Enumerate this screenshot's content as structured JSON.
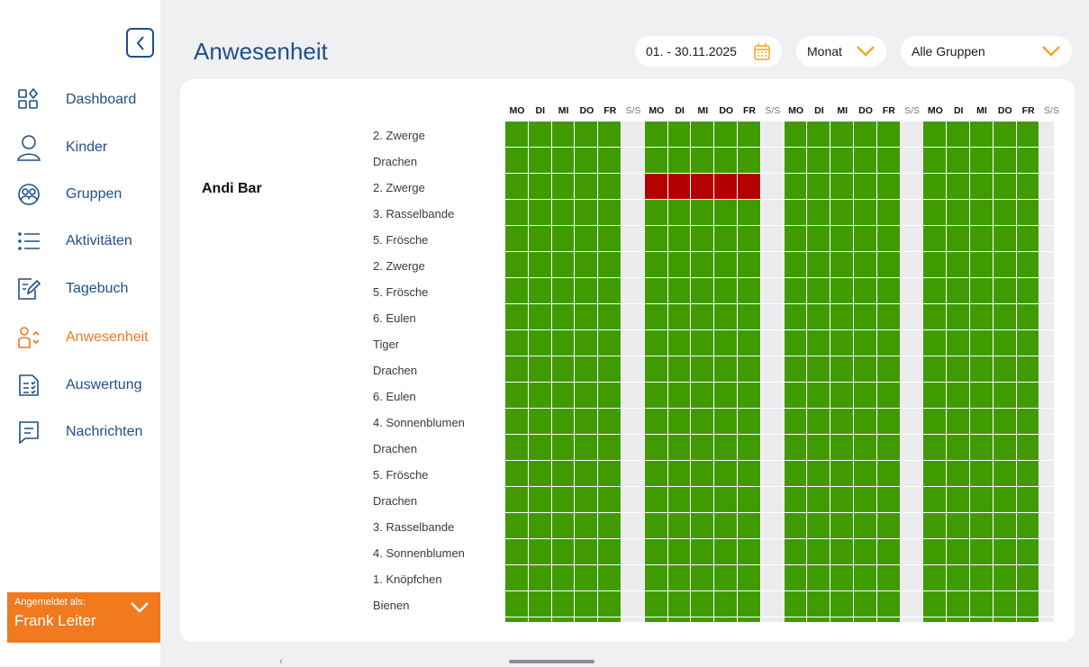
{
  "app": {
    "title": "Anwesenheit"
  },
  "sidebar": {
    "items": [
      {
        "label": "Dashboard",
        "icon": "dashboard-icon"
      },
      {
        "label": "Kinder",
        "icon": "person-icon"
      },
      {
        "label": "Gruppen",
        "icon": "group-icon"
      },
      {
        "label": "Aktivitäten",
        "icon": "list-icon"
      },
      {
        "label": "Tagebuch",
        "icon": "diary-icon"
      },
      {
        "label": "Anwesenheit",
        "icon": "attendance-icon",
        "active": true
      },
      {
        "label": "Auswertung",
        "icon": "report-icon"
      },
      {
        "label": "Nachrichten",
        "icon": "message-icon"
      }
    ],
    "login_caption": "Angemeldet als:",
    "login_user": "Frank Leiter"
  },
  "toolbar": {
    "date_range": "01. - 30.11.2025",
    "period": "Monat",
    "group_filter": "Alle Gruppen"
  },
  "colors": {
    "accent": "#f07a1d",
    "primary": "#1e4f8a",
    "present": "#3f9b00",
    "absent": "#b40000",
    "weekend": "#ececef"
  },
  "attendance": {
    "child_name": "Andi Bar",
    "day_headers": [
      "MO",
      "DI",
      "MI",
      "DO",
      "FR",
      "S/S",
      "MO",
      "DI",
      "MI",
      "DO",
      "FR",
      "S/S",
      "MO",
      "DI",
      "MI",
      "DO",
      "FR",
      "S/S",
      "MO",
      "DI",
      "MI",
      "DO",
      "FR",
      "S/S"
    ],
    "groups": [
      "2. Zwerge",
      "Drachen",
      "2. Zwerge",
      "3. Rasselbande",
      "5. Frösche",
      "2. Zwerge",
      "5. Frösche",
      "6. Eulen",
      "Tiger",
      "Drachen",
      "6. Eulen",
      "4. Sonnenblumen",
      "Drachen",
      "5. Frösche",
      "Drachen",
      "3. Rasselbande",
      "4. Sonnenblumen",
      "1. Knöpfchen",
      "Bienen"
    ],
    "absent_cells": [
      {
        "row": 2,
        "days": [
          6,
          7,
          8,
          9,
          10
        ]
      }
    ]
  }
}
